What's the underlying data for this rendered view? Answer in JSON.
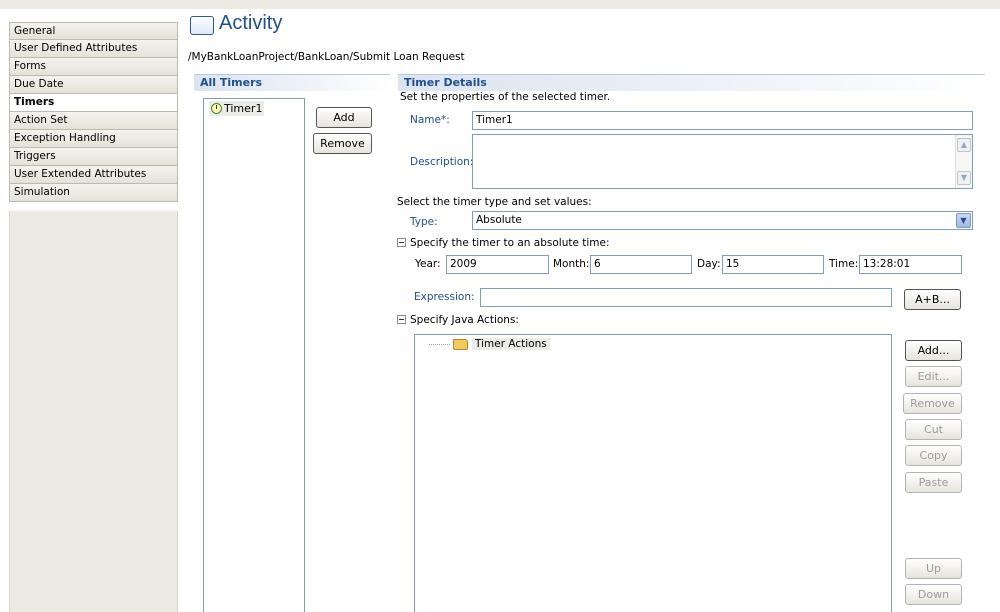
{
  "nav": {
    "items": [
      {
        "label": "General",
        "active": false
      },
      {
        "label": "User Defined Attributes",
        "active": false
      },
      {
        "label": "Forms",
        "active": false
      },
      {
        "label": "Due Date",
        "active": false
      },
      {
        "label": "Timers",
        "active": true
      },
      {
        "label": "Action Set",
        "active": false
      },
      {
        "label": "Exception Handling",
        "active": false
      },
      {
        "label": "Triggers",
        "active": false
      },
      {
        "label": "User Extended Attributes",
        "active": false
      },
      {
        "label": "Simulation",
        "active": false
      }
    ]
  },
  "header": {
    "title": "Activity",
    "icon": "activity-icon",
    "breadcrumb": "/MyBankLoanProject/BankLoan/Submit Loan Request"
  },
  "all_timers": {
    "heading": "All Timers",
    "items": [
      "Timer1"
    ],
    "add_label": "Add",
    "remove_label": "Remove"
  },
  "details": {
    "heading": "Timer Details",
    "subtitle": "Set the properties of the selected timer.",
    "name_label": "Name*:",
    "name_value": "Timer1",
    "description_label": "Description:",
    "description_value": "",
    "type_prompt": "Select the timer type and set values:",
    "type_label": "Type:",
    "type_value": "Absolute",
    "absolute_heading": "Specify the timer to an absolute time:",
    "year_label": "Year:",
    "year_value": "2009",
    "month_label": "Month:",
    "month_value": "6",
    "day_label": "Day:",
    "day_value": "15",
    "time_label": "Time:",
    "time_value": "13:28:01",
    "expression_label": "Expression:",
    "expression_value": "",
    "expression_button": "A+B...",
    "java_heading": "Specify Java Actions:",
    "tree_root": "Timer Actions",
    "buttons": {
      "add": "Add...",
      "edit": "Edit...",
      "remove": "Remove",
      "cut": "Cut",
      "copy": "Copy",
      "paste": "Paste",
      "up": "Up",
      "down": "Down"
    }
  },
  "colors": {
    "accent": "#1f4f93",
    "field_border": "#7f9db9",
    "nav_bg": "#eceae2"
  }
}
